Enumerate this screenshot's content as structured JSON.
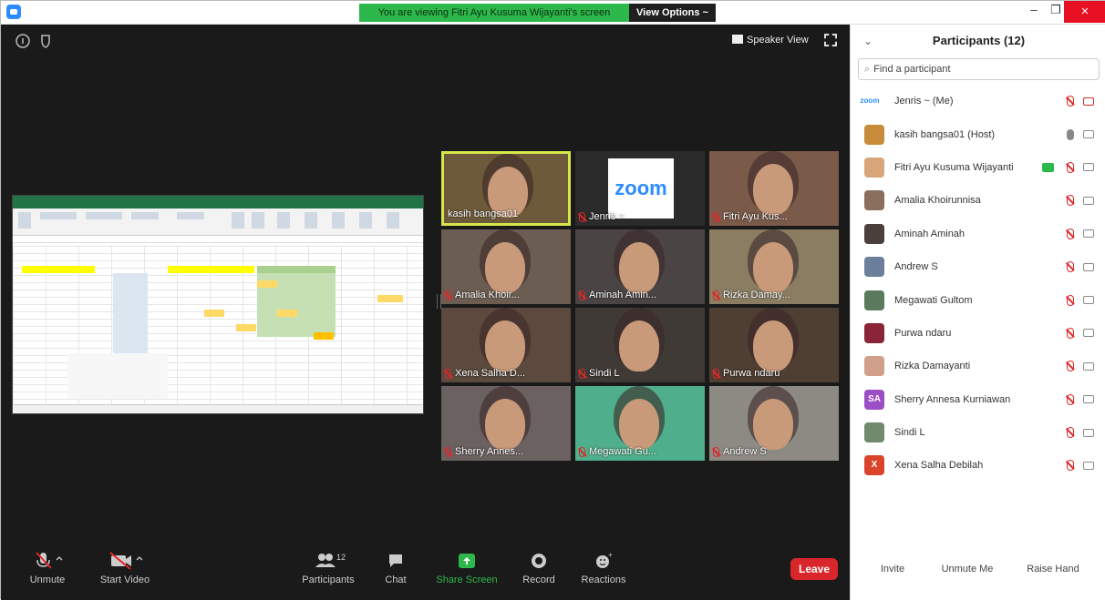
{
  "banner": {
    "text": "You are viewing Fitri Ayu Kusuma Wijayanti's screen",
    "view_options": "View Options ~"
  },
  "window": {
    "minimize": "–",
    "restore": "❐",
    "close": "✕"
  },
  "top": {
    "speaker_view": "Speaker View"
  },
  "tiles": [
    {
      "name": "kasih bangsa01",
      "active": true,
      "muted": false,
      "bg": "#6d5a3a"
    },
    {
      "name": "Jenris ~",
      "muted": true,
      "zoom": "zoom",
      "bg": "#2b2b2b"
    },
    {
      "name": "Fitri Ayu Kus...",
      "muted": true,
      "bg": "#7a5a49"
    },
    {
      "name": "Amalia Khoir...",
      "muted": true,
      "bg": "#6b5d52"
    },
    {
      "name": "Aminah Amin...",
      "muted": true,
      "bg": "#4a4444"
    },
    {
      "name": "Rizka Damay...",
      "muted": true,
      "bg": "#8a7d62"
    },
    {
      "name": "Xena Salha D...",
      "muted": true,
      "bg": "#5b4a3d"
    },
    {
      "name": "Sindi L",
      "muted": true,
      "bg": "#3f3a35"
    },
    {
      "name": "Purwa ndaru",
      "muted": true,
      "bg": "#4f3e32"
    },
    {
      "name": "Sherry Annes...",
      "muted": true,
      "bg": "#6a6160"
    },
    {
      "name": "Megawati Gu...",
      "muted": true,
      "bg": "#4fae8b"
    },
    {
      "name": "Andrew S",
      "muted": true,
      "bg": "#8d8a84"
    }
  ],
  "toolbar": {
    "unmute": "Unmute",
    "start_video": "Start Video",
    "participants": "Participants",
    "participants_count": "12",
    "chat": "Chat",
    "share_screen": "Share Screen",
    "record": "Record",
    "reactions": "Reactions",
    "leave": "Leave"
  },
  "panel": {
    "title": "Participants (12)",
    "search_placeholder": "Find a participant",
    "participants": [
      {
        "name": "Jenris ~ (Me)",
        "avatar": "zoom",
        "color": "#2d8cff",
        "mic": "off",
        "cam": "off"
      },
      {
        "name": "kasih bangsa01 (Host)",
        "avatar": "",
        "color": "#c78b3a",
        "mic": "on",
        "cam": "on"
      },
      {
        "name": "Fitri Ayu Kusuma Wijayanti",
        "avatar": "",
        "color": "#d9a57a",
        "mic": "off",
        "cam": "on",
        "sharing": true
      },
      {
        "name": "Amalia Khoirunnisa",
        "avatar": "",
        "color": "#8a6f5e",
        "mic": "off",
        "cam": "on"
      },
      {
        "name": "Aminah Aminah",
        "avatar": "",
        "color": "#4a3f3a",
        "mic": "off",
        "cam": "on"
      },
      {
        "name": "Andrew S",
        "avatar": "",
        "color": "#6b7f9a",
        "mic": "off",
        "cam": "on"
      },
      {
        "name": "Megawati Gultom",
        "avatar": "",
        "color": "#5a7a5e",
        "mic": "off",
        "cam": "on"
      },
      {
        "name": "Purwa ndaru",
        "avatar": "",
        "color": "#8a2438",
        "mic": "off",
        "cam": "on"
      },
      {
        "name": "Rizka Damayanti",
        "avatar": "",
        "color": "#d0a08a",
        "mic": "off",
        "cam": "on"
      },
      {
        "name": "Sherry Annesa Kurniawan",
        "avatar": "SA",
        "color": "#9b4fc4",
        "mic": "off",
        "cam": "on"
      },
      {
        "name": "Sindi L",
        "avatar": "",
        "color": "#6f8a6c",
        "mic": "off",
        "cam": "on"
      },
      {
        "name": "Xena Salha Debilah",
        "avatar": "X",
        "color": "#d9452b",
        "mic": "off",
        "cam": "on"
      }
    ],
    "invite": "Invite",
    "unmute_me": "Unmute Me",
    "raise_hand": "Raise Hand"
  }
}
